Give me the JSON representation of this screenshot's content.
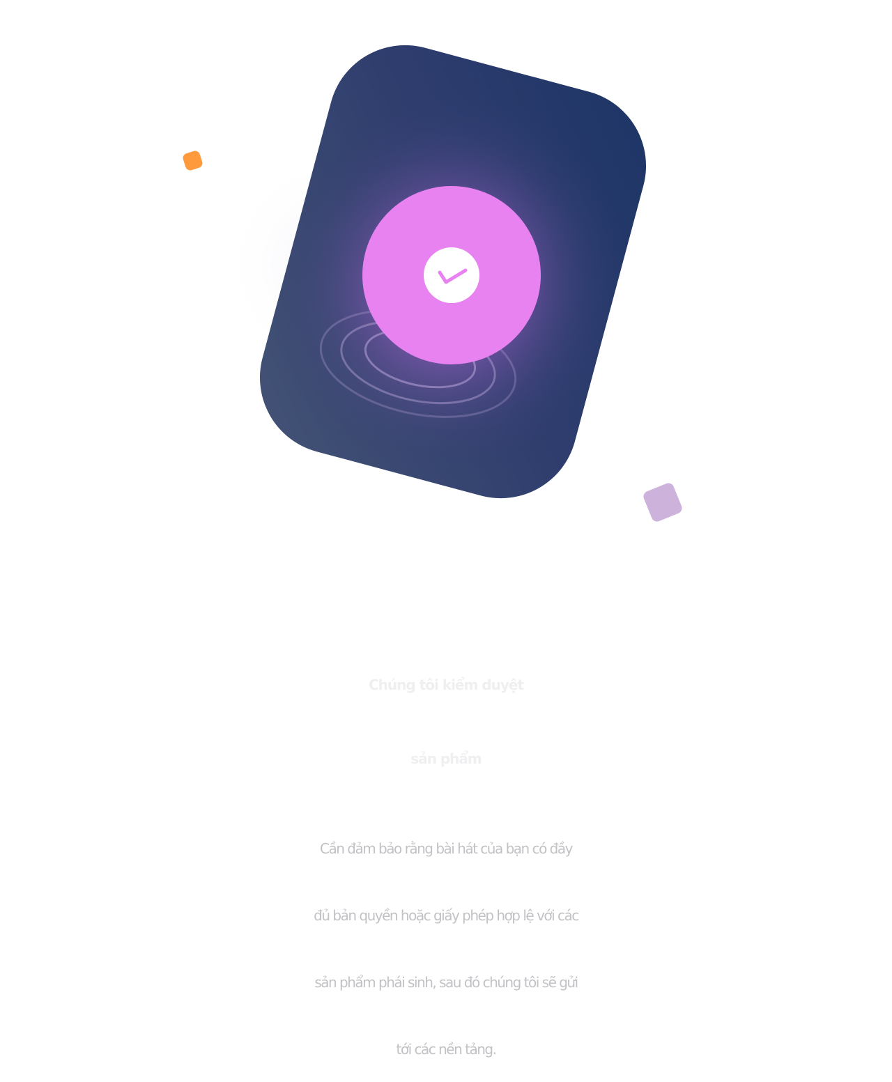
{
  "feature": {
    "title_lines": [
      "Chúng tôi kiểm duyệt",
      "sản phẩm"
    ],
    "description_lines": [
      "Cần đảm bảo rằng bài hát của bạn có đầy",
      "đủ bản quyền hoặc giấy phép hợp lệ với các",
      "sản phẩm phái sinh, sau đó chúng tôi sẽ gửi",
      "tới các nền tảng."
    ]
  },
  "illustration": {
    "icons": [
      "check-circle-icon"
    ],
    "colors": {
      "card_dark": "#1f3566",
      "card_slate": "#445375",
      "glow_violet": "#9a68c8",
      "disc_pink": "#e882f0",
      "accent_orange": "#ff9a3c",
      "accent_lilac": "#cdb2dc",
      "title_text": "#efeff1",
      "body_text": "#c2c2c6"
    }
  }
}
